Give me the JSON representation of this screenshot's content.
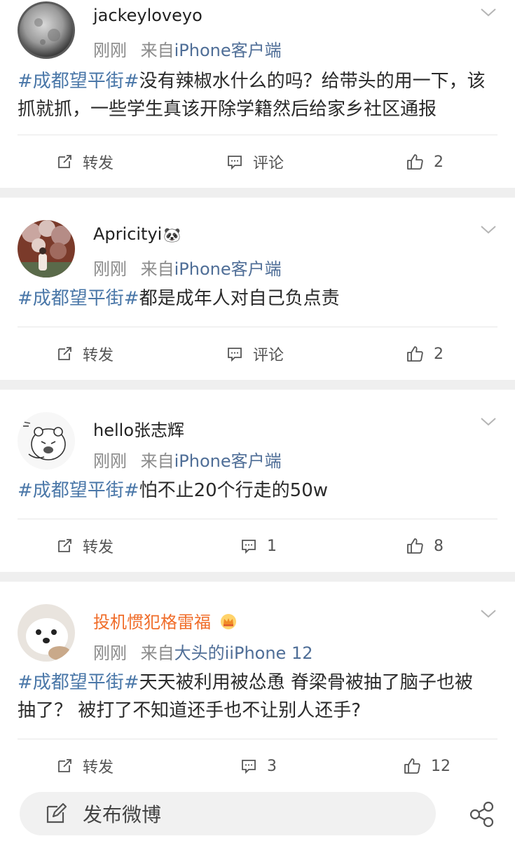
{
  "posts": [
    {
      "username": "jackeyloveyo",
      "time": "刚刚",
      "from_prefix": "来自",
      "source": "iPhone客户端",
      "topic": "#成都望平街#",
      "text": "没有辣椒水什么的吗？给带头的用一下，该抓就抓，一些学生真该开除学籍然后给家乡社区通报",
      "repost": "转发",
      "comment": "评论",
      "likes": "2"
    },
    {
      "username": "Apricityi",
      "username_emoji": "🐼",
      "time": "刚刚",
      "from_prefix": "来自",
      "source": "iPhone客户端",
      "topic": "#成都望平街#",
      "text": "都是成年人对自己负点责",
      "repost": "转发",
      "comment": "评论",
      "likes": "2"
    },
    {
      "username": "hello张志辉",
      "time": "刚刚",
      "from_prefix": "来自",
      "source": "iPhone客户端",
      "topic": "#成都望平街#",
      "text": "怕不止20个行走的50w",
      "repost": "转发",
      "comment": "1",
      "likes": "8"
    },
    {
      "username": "投机惯犯格雷福",
      "time": "刚刚",
      "from_prefix": "来自",
      "source": "大头的iiPhone 12",
      "topic": "#成都望平街#",
      "text": "天天被利用被怂恿 脊梁骨被抽了脑子也被抽了？ 被打了不知道还手也不让别人还手?",
      "repost": "转发",
      "comment": "3",
      "likes": "12"
    }
  ],
  "bottom_bar": {
    "compose_label": "发布微博"
  },
  "colors": {
    "topic": "#4a77a8",
    "source": "#4f6e97",
    "vip_name": "#f06d2a",
    "separator": "#efefef"
  }
}
